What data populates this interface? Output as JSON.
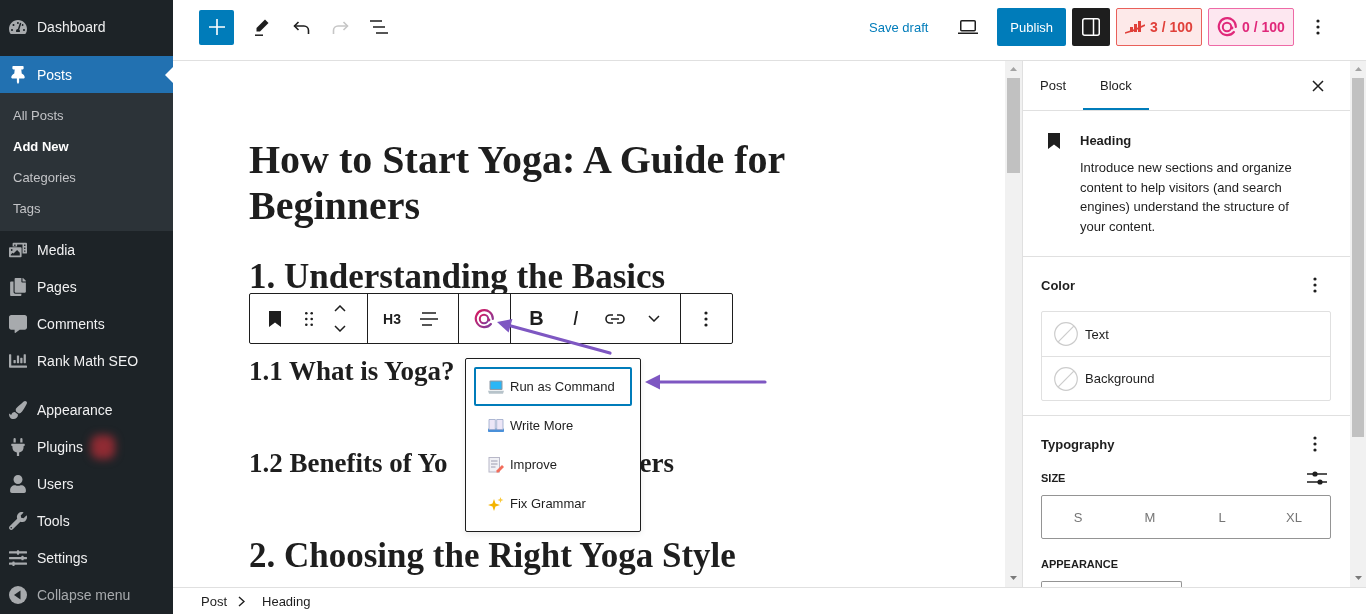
{
  "admin_menu": {
    "groups": [
      {
        "items": [
          {
            "label": "Dashboard",
            "selected": false,
            "badge_blurred": false
          }
        ]
      },
      {
        "items": [
          {
            "label": "Posts",
            "selected": true,
            "badge_blurred": false,
            "submenu": [
              {
                "label": "All Posts",
                "selected": false
              },
              {
                "label": "Add New",
                "selected": true
              },
              {
                "label": "Categories",
                "selected": false
              },
              {
                "label": "Tags",
                "selected": false
              }
            ]
          },
          {
            "label": "Media",
            "selected": false,
            "badge_blurred": false
          },
          {
            "label": "Pages",
            "selected": false,
            "badge_blurred": false
          },
          {
            "label": "Comments",
            "selected": false,
            "badge_blurred": false
          },
          {
            "label": "Rank Math SEO",
            "selected": false,
            "badge_blurred": false
          }
        ]
      },
      {
        "items": [
          {
            "label": "Appearance",
            "selected": false,
            "badge_blurred": false
          },
          {
            "label": "Plugins",
            "selected": false,
            "badge_blurred": true
          },
          {
            "label": "Users",
            "selected": false,
            "badge_blurred": false
          },
          {
            "label": "Tools",
            "selected": false,
            "badge_blurred": false
          },
          {
            "label": "Settings",
            "selected": false,
            "badge_blurred": false
          }
        ]
      }
    ],
    "collapse_label": "Collapse menu"
  },
  "top_bar": {
    "undo_disabled": false,
    "redo_disabled": true,
    "save_draft": "Save draft",
    "publish": "Publish",
    "settings_pressed": true,
    "seo_score": "3 / 100",
    "ai_credits": "0 / 100"
  },
  "editor": {
    "title": "How to Start Yoga: A Guide for Beginners",
    "blocks": [
      {
        "kind": "h2",
        "text": "1. Understanding the Basics",
        "selected": false
      },
      {
        "kind": "h3",
        "text": "1.1 What is Yoga?",
        "selected": true
      },
      {
        "kind": "h3",
        "text_parts": [
          "1.2 Benefits of Yo",
          "ers"
        ],
        "selected": false
      },
      {
        "kind": "h2",
        "text": "2. Choosing the Right Yoga Style",
        "selected": false
      }
    ]
  },
  "block_toolbar": {
    "heading_level": "H3",
    "bold": "B",
    "italic": "I"
  },
  "ai_menu": {
    "items": [
      {
        "label": "Run as Command",
        "focused": true
      },
      {
        "label": "Write More",
        "focused": false
      },
      {
        "label": "Improve",
        "focused": false
      },
      {
        "label": "Fix Grammar",
        "focused": false
      }
    ]
  },
  "inspector": {
    "tabs": [
      {
        "label": "Post",
        "selected": false
      },
      {
        "label": "Block",
        "selected": true
      }
    ],
    "block_card": {
      "title": "Heading",
      "description": "Introduce new sections and organize content to help visitors (and search engines) understand the structure of your content."
    },
    "color": {
      "title": "Color",
      "items": [
        "Text",
        "Background"
      ]
    },
    "typography": {
      "title": "Typography",
      "size_label": "SIZE",
      "sizes": [
        {
          "label": "S",
          "selected": false
        },
        {
          "label": "M",
          "selected": false
        },
        {
          "label": "L",
          "selected": false
        },
        {
          "label": "XL",
          "selected": false
        }
      ],
      "appearance_label": "APPEARANCE"
    }
  },
  "breadcrumbs": [
    "Post",
    "Heading"
  ]
}
